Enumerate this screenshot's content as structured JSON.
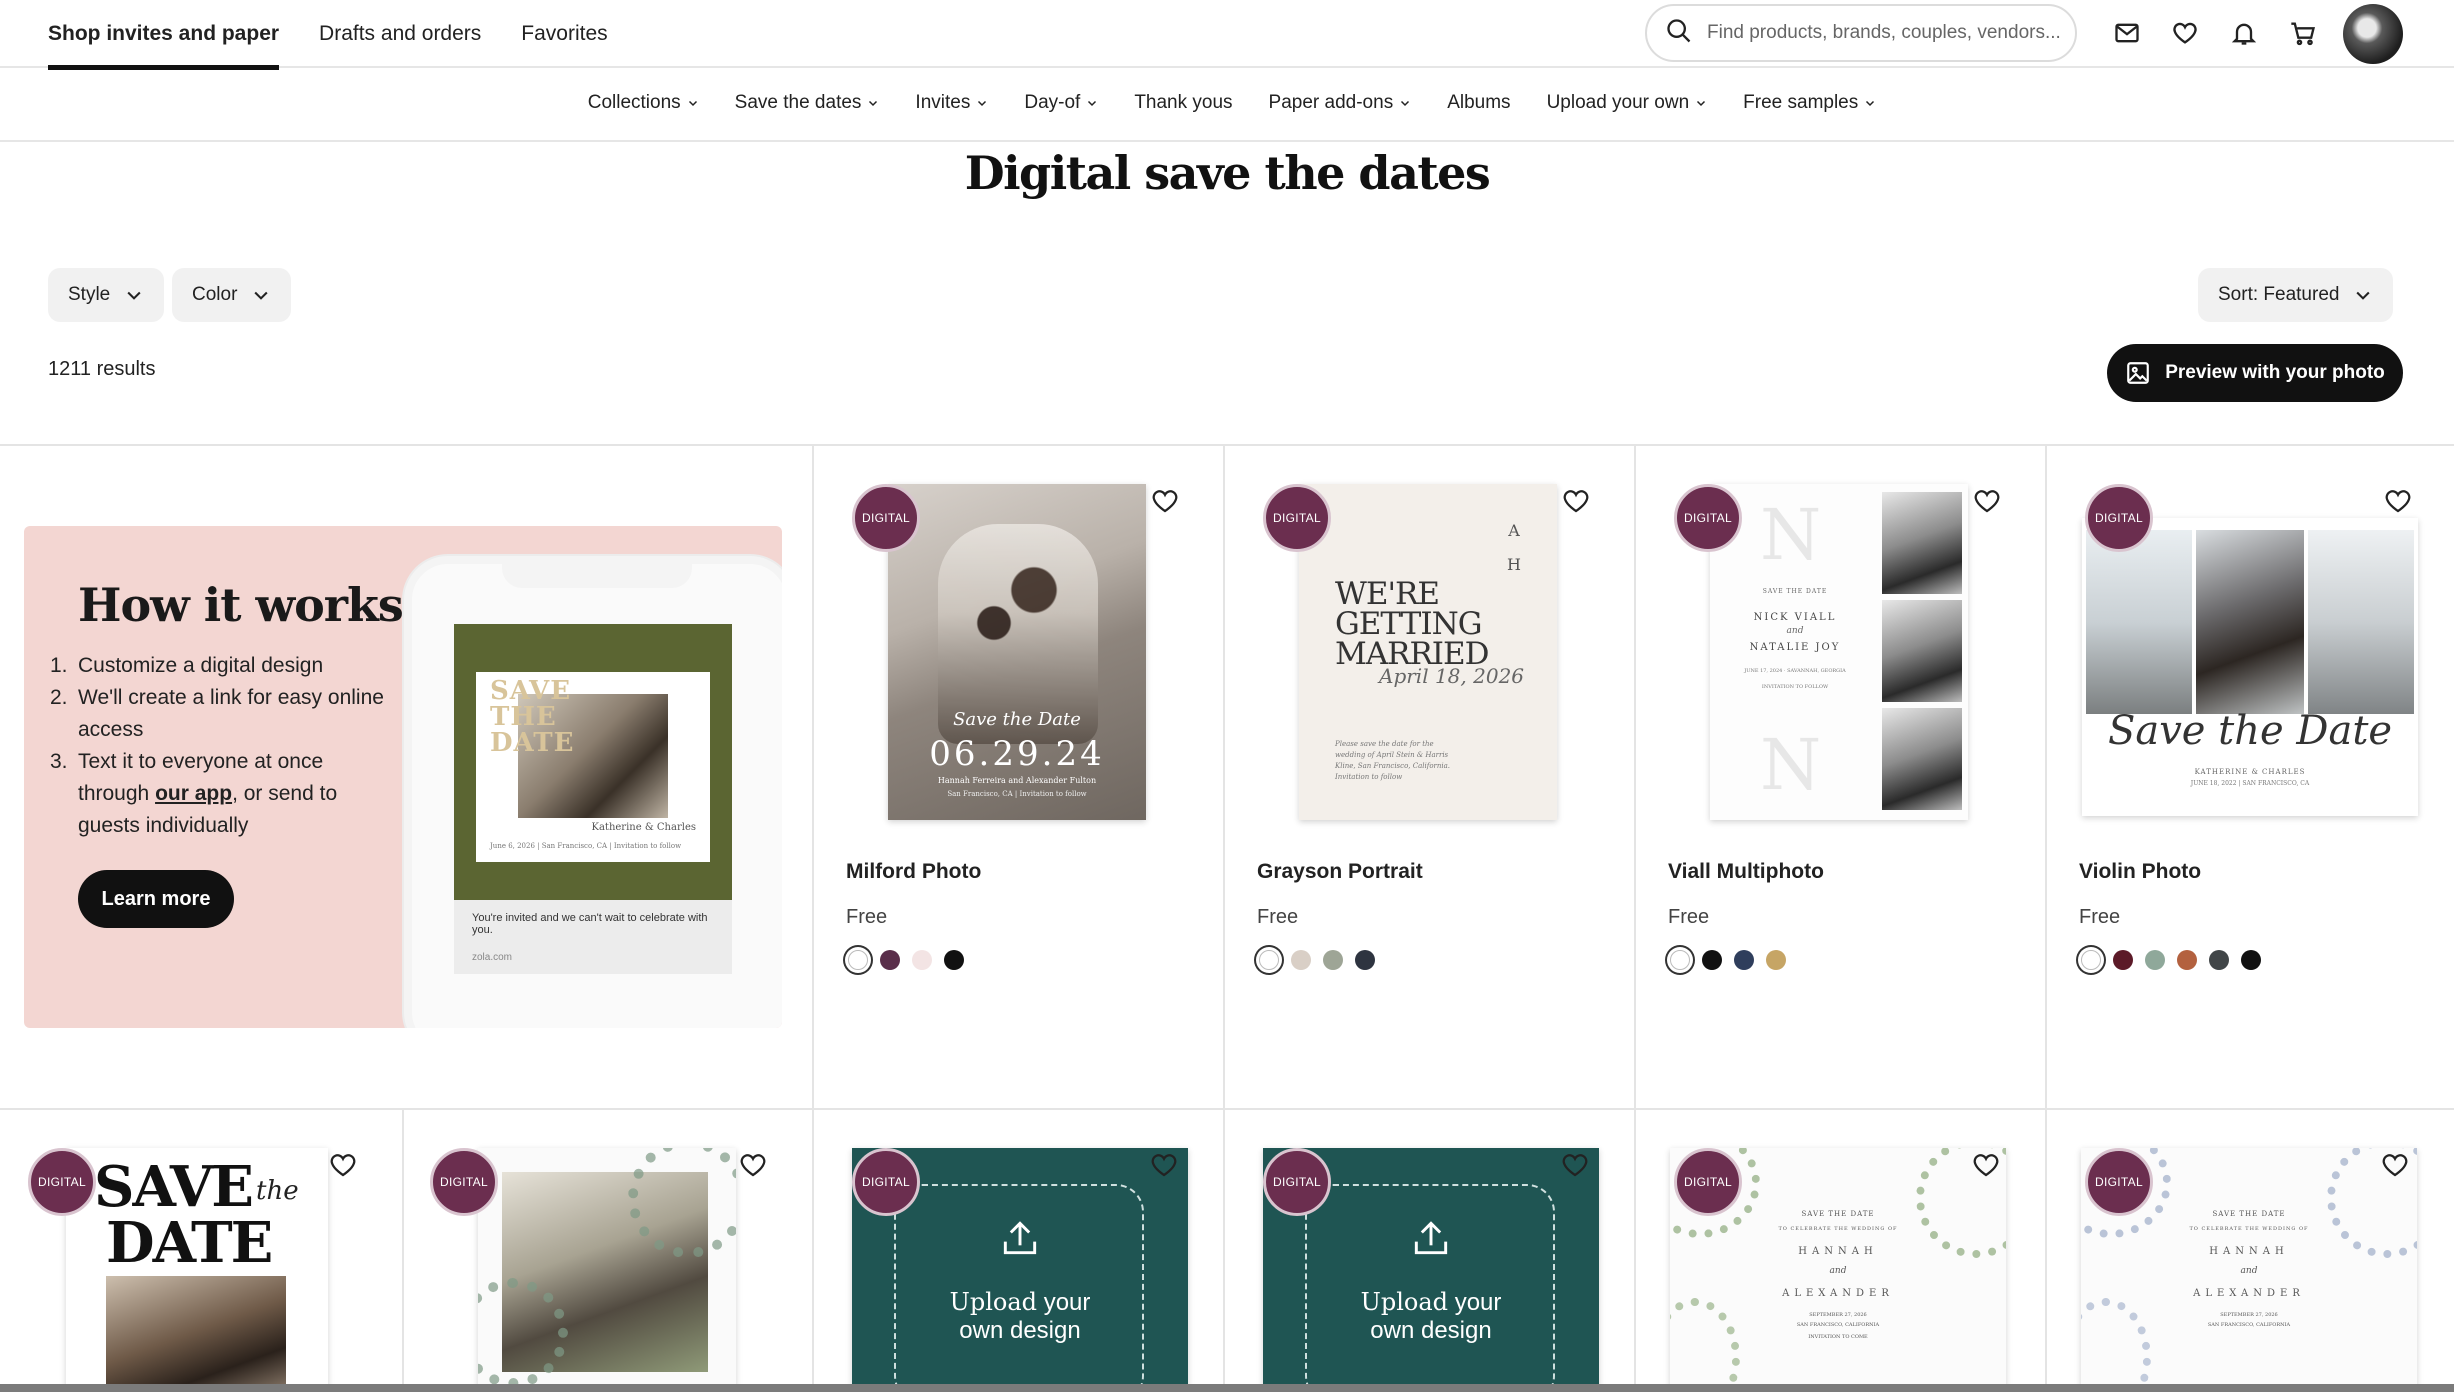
{
  "nav": {
    "tabs": [
      {
        "label": "Shop invites and paper",
        "active": true
      },
      {
        "label": "Drafts and orders",
        "active": false
      },
      {
        "label": "Favorites",
        "active": false
      }
    ],
    "search_placeholder": "Find products, brands, couples, vendors...",
    "icons": [
      "search-icon",
      "mail-icon",
      "heart-icon",
      "bell-icon",
      "cart-icon"
    ]
  },
  "categories": [
    "Collections",
    "Save the dates",
    "Invites",
    "Day-of",
    "Thank yous",
    "Paper add-ons",
    "Albums",
    "Upload your own",
    "Free samples"
  ],
  "category_has_dropdown": [
    true,
    true,
    true,
    true,
    false,
    true,
    false,
    true,
    true
  ],
  "page_title": "Digital save the dates",
  "filters": {
    "style": "Style",
    "color": "Color",
    "sort": "Sort: Featured"
  },
  "results": "1211 results",
  "preview_button": "Preview with your photo",
  "how_it_works": {
    "title": "How it works",
    "steps": [
      {
        "n": "1.",
        "text": "Customize a digital design"
      },
      {
        "n": "2.",
        "text": "We'll create a link for easy online access"
      },
      {
        "n": "3.",
        "pre": "Text it to everyone at once through ",
        "link": "our app",
        "post": ", or send to guests individually"
      }
    ],
    "cta": "Learn more",
    "phone": {
      "card_text": "SAVE THE DATE",
      "names": "Katherine & Charles",
      "date_line": "June 6, 2026 | San Francisco, CA | Invitation to follow",
      "message": "You're invited and we can't wait to celebrate with you.",
      "url": "zola.com"
    }
  },
  "badge_label": "DIGITAL",
  "products": [
    {
      "name": "Milford Photo",
      "price": "Free",
      "swatches": [
        "#ffffff",
        "#5a2e4a",
        "#f3e4e4",
        "#111111"
      ],
      "art": {
        "script": "Save the Date",
        "date": "06.29.24",
        "names": "Hannah Ferreira and Alexander Fulton",
        "place": "San Francisco, CA | Invitation to follow"
      }
    },
    {
      "name": "Grayson Portrait",
      "price": "Free",
      "swatches": [
        "#ffffff",
        "#d9cfc6",
        "#9ea596",
        "#2e3440"
      ],
      "art": {
        "initials": "A H",
        "headline": "WE'RE GETTING MARRIED",
        "script": "April 18, 2026",
        "body": "Please save the date for the wedding of April Stein & Harris Kline, San Francisco, California. Invitation to follow"
      }
    },
    {
      "name": "Viall Multiphoto",
      "price": "Free",
      "swatches": [
        "#ffffff",
        "#111111",
        "#2f3e5c",
        "#c6a565"
      ],
      "art": {
        "letter": "N",
        "top": "SAVE THE DATE",
        "name1": "NICK VIALL",
        "and": "and",
        "name2": "NATALIE JOY",
        "date": "JUNE 17, 2024 · SAVANNAH, GEORGIA",
        "follow": "INVITATION TO FOLLOW"
      }
    },
    {
      "name": "Violin Photo",
      "price": "Free",
      "swatches": [
        "#ffffff",
        "#5c1a28",
        "#8fa89a",
        "#b3613f",
        "#414648",
        "#111111"
      ],
      "art": {
        "script": "Save the Date",
        "names": "KATHERINE & CHARLES",
        "date": "JUNE 18, 2022 | SAN FRANCISCO, CA"
      }
    }
  ],
  "row2": [
    {
      "kind": "savedate",
      "line1": "SAVE",
      "line2": "DATE",
      "script": "the"
    },
    {
      "kind": "floral-photo"
    },
    {
      "kind": "upload",
      "label1": "Upload",
      "label2": "your",
      "label3": "own design"
    },
    {
      "kind": "upload",
      "label1": "Upload",
      "label2": "your",
      "label3": "own design"
    },
    {
      "kind": "text-card",
      "top": "SAVE THE DATE",
      "sub": "TO CELEBRATE THE WEDDING OF",
      "name1": "HANNAH",
      "and": "and",
      "name2": "ALEXANDER",
      "date": "SEPTEMBER 27, 2026",
      "place": "SAN FRANCISCO, CALIFORNIA",
      "follow": "INVITATION TO COME"
    },
    {
      "kind": "text-card",
      "top": "SAVE THE DATE",
      "sub": "TO CELEBRATE THE WEDDING OF",
      "name1": "HANNAH",
      "and": "and",
      "name2": "ALEXANDER",
      "date": "SEPTEMBER 27, 2026",
      "place": "SAN FRANCISCO, CALIFORNIA",
      "follow": ""
    }
  ]
}
